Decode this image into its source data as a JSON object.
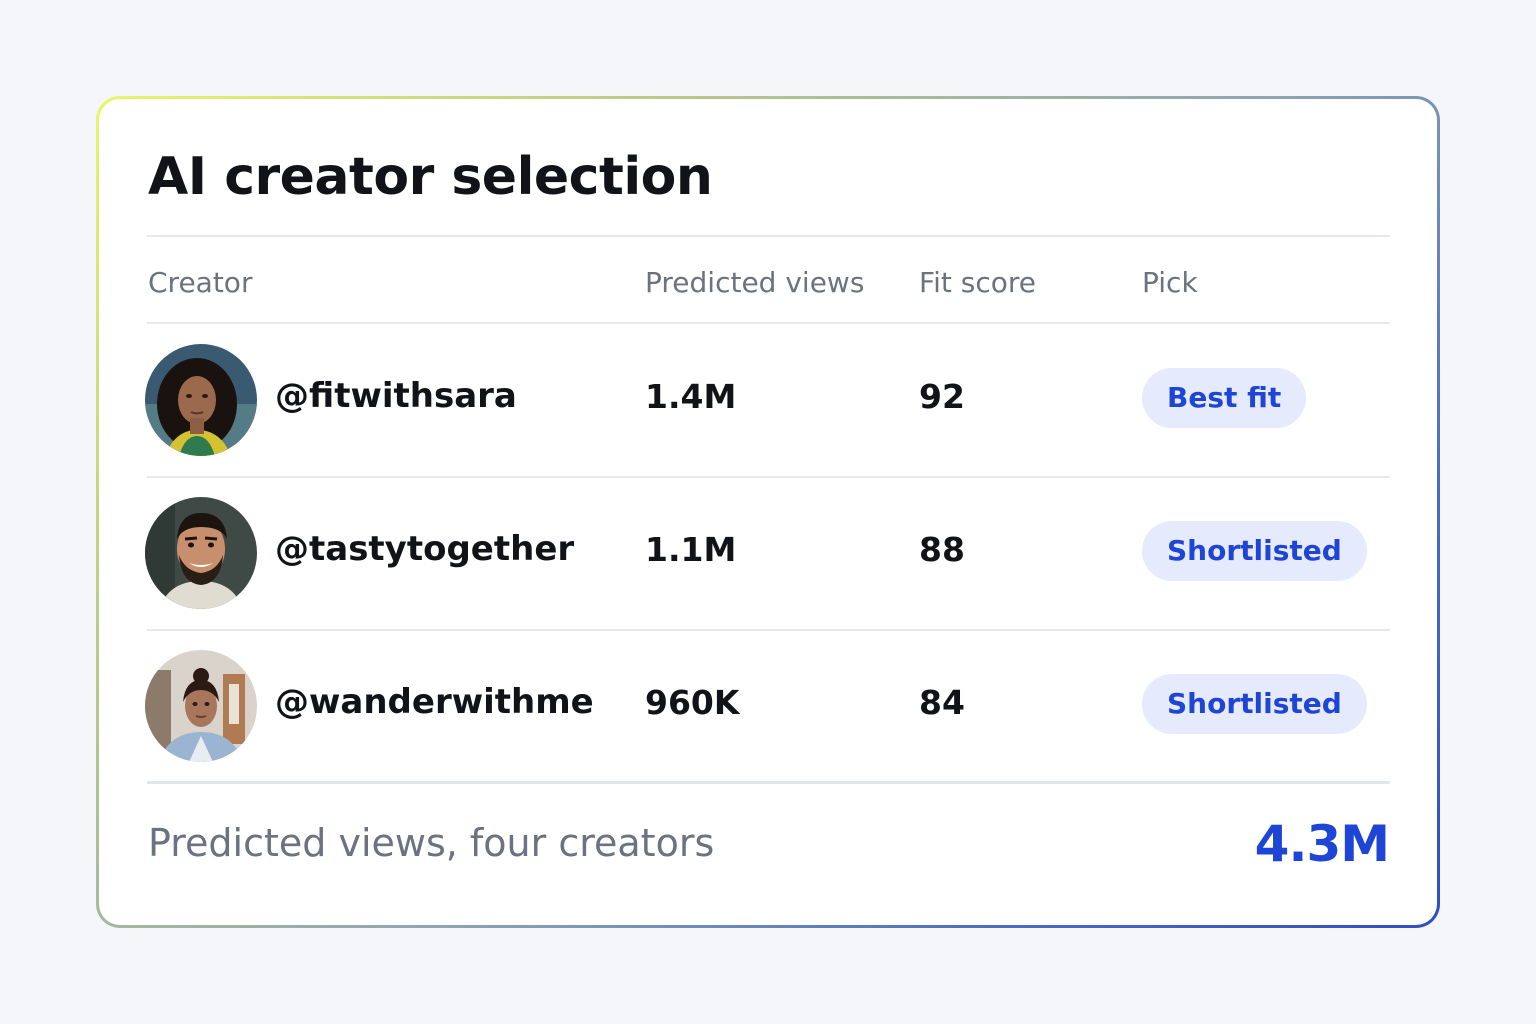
{
  "title": "AI creator selection",
  "columns": {
    "creator": "Creator",
    "views": "Predicted views",
    "fit": "Fit score",
    "pick": "Pick"
  },
  "rows": [
    {
      "handle": "@fitwithsara",
      "views": "1.4M",
      "fit": "92",
      "pick": "Best fit",
      "avatar": "avatar-woman-curly-hair"
    },
    {
      "handle": "@tastytogether",
      "views": "1.1M",
      "fit": "88",
      "pick": "Shortlisted",
      "avatar": "avatar-man-beard"
    },
    {
      "handle": "@wanderwithme",
      "views": "960K",
      "fit": "84",
      "pick": "Shortlisted",
      "avatar": "avatar-woman-office"
    }
  ],
  "footer": {
    "label": "Predicted views, four creators",
    "total": "4.3M"
  },
  "colors": {
    "accent": "#1f45d6",
    "pill_bg": "#e5ebfd",
    "border_gradient_start": "#e8f56a",
    "border_gradient_end": "#2d4fc2"
  }
}
